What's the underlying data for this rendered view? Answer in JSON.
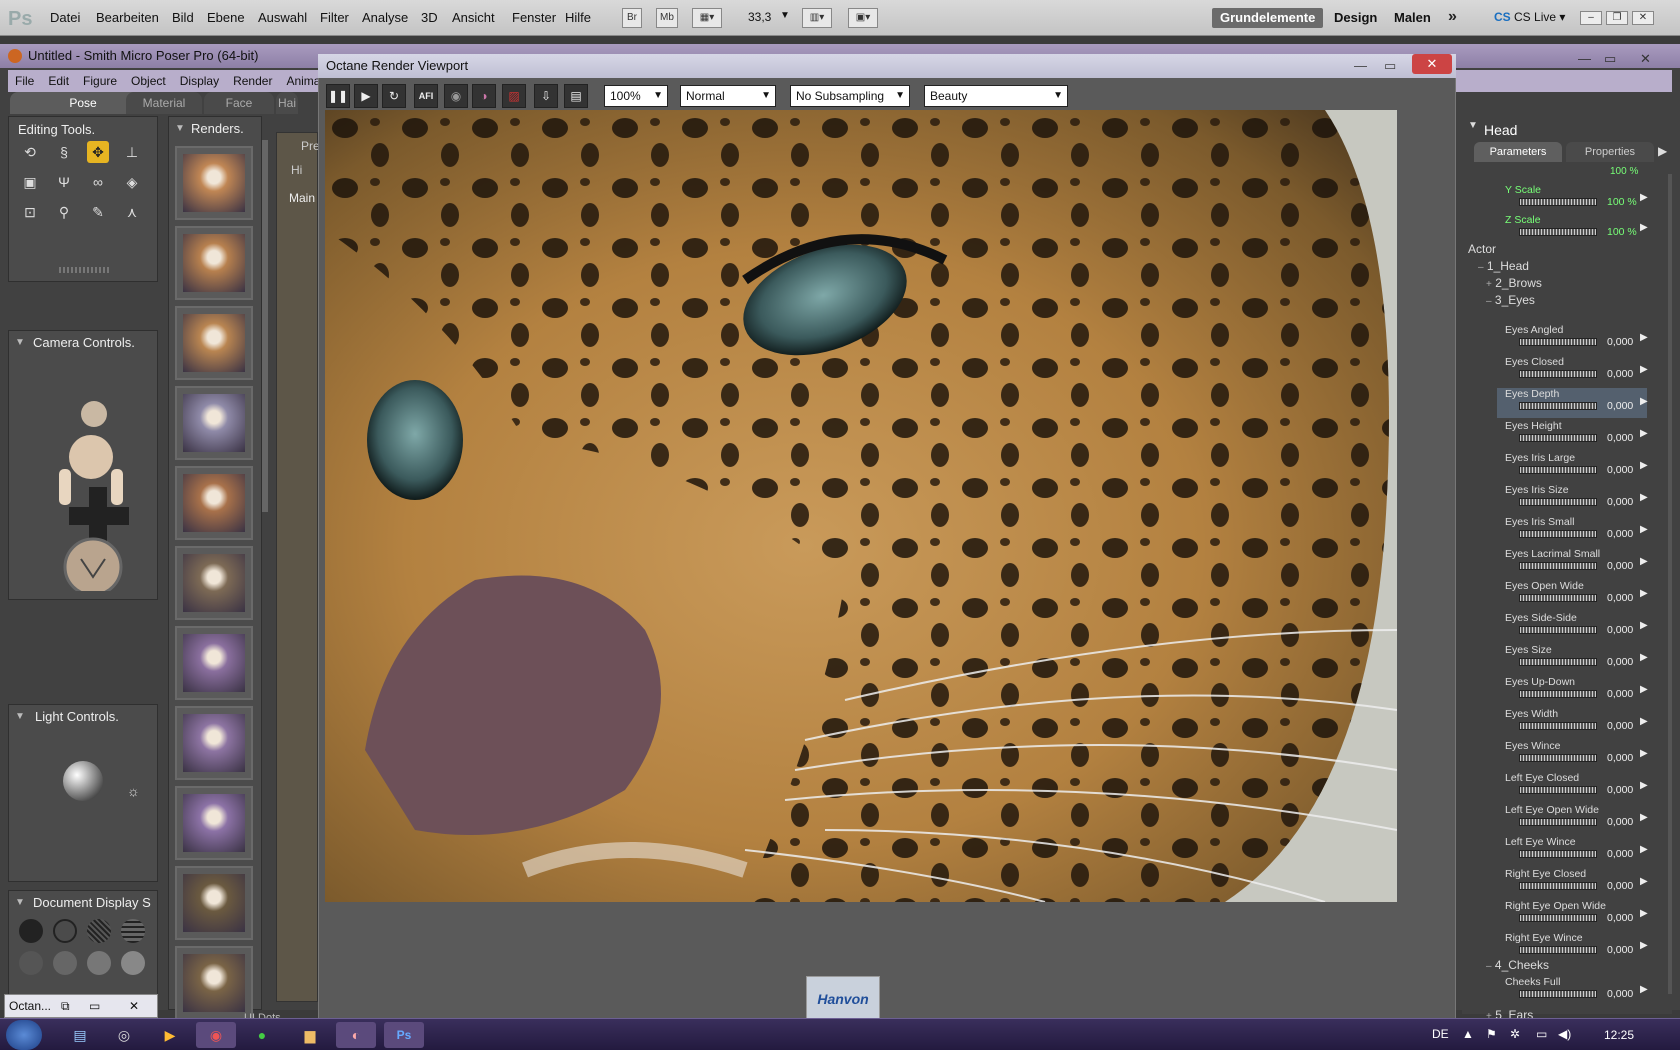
{
  "photoshop": {
    "logo": "Ps",
    "menu": [
      "Datei",
      "Bearbeiten",
      "Bild",
      "Ebene",
      "Auswahl",
      "Filter",
      "Analyse",
      "3D",
      "Ansicht",
      "Fenster",
      "Hilfe"
    ],
    "tool_badges": [
      "Br",
      "Mb"
    ],
    "zoom": "33,3",
    "workspaces": [
      "Grundelemente",
      "Design",
      "Malen"
    ],
    "overflow": "»",
    "cs_live": "CS Live"
  },
  "poser": {
    "title": "Untitled - Smith Micro Poser Pro  (64-bit)",
    "menu": [
      "File",
      "Edit",
      "Figure",
      "Object",
      "Display",
      "Render",
      "Animat"
    ],
    "tabs": [
      "Pose",
      "Material",
      "Face",
      "Hai"
    ],
    "editing_tools": "Editing Tools.",
    "renders": "Renders.",
    "camera_controls": "Camera Controls.",
    "light_controls": "Light Controls.",
    "document_display": "Document Display S",
    "behind_labels": {
      "pre": "Pre",
      "hi": "Hi",
      "main": "Main"
    },
    "bottom_label": "UI Dots"
  },
  "octane": {
    "title": "Octane Render Viewport",
    "zoom": "100%",
    "mode": "Normal",
    "subsampling": "No Subsampling",
    "pass": "Beauty",
    "afi_label": "AFI",
    "watermark": "Hanvon"
  },
  "right_panel": {
    "title": "Head",
    "tabs": [
      "Parameters",
      "Properties"
    ],
    "top_value": "100 %",
    "scales": [
      {
        "name": "Y Scale",
        "value": "100 %"
      },
      {
        "name": "Z Scale",
        "value": "100 %"
      }
    ],
    "tree": [
      "Actor",
      "1_Head",
      "2_Brows",
      "3_Eyes",
      "4_Cheeks",
      "5_Ears"
    ],
    "params": [
      {
        "name": "Eyes Angled",
        "value": "0,000"
      },
      {
        "name": "Eyes Closed",
        "value": "0,000"
      },
      {
        "name": "Eyes Depth",
        "value": "0,000"
      },
      {
        "name": "Eyes Height",
        "value": "0,000"
      },
      {
        "name": "Eyes Iris Large",
        "value": "0,000"
      },
      {
        "name": "Eyes Iris Size",
        "value": "0,000"
      },
      {
        "name": "Eyes Iris Small",
        "value": "0,000"
      },
      {
        "name": "Eyes Lacrimal Small",
        "value": "0,000"
      },
      {
        "name": "Eyes Open Wide",
        "value": "0,000"
      },
      {
        "name": "Eyes Side-Side",
        "value": "0,000"
      },
      {
        "name": "Eyes Size",
        "value": "0,000"
      },
      {
        "name": "Eyes Up-Down",
        "value": "0,000"
      },
      {
        "name": "Eyes Width",
        "value": "0,000"
      },
      {
        "name": "Eyes Wince",
        "value": "0,000"
      },
      {
        "name": "Left Eye Closed",
        "value": "0,000"
      },
      {
        "name": "Left Eye Open Wide",
        "value": "0,000"
      },
      {
        "name": "Left Eye Wince",
        "value": "0,000"
      },
      {
        "name": "Right Eye Closed",
        "value": "0,000"
      },
      {
        "name": "Right Eye Open Wide",
        "value": "0,000"
      },
      {
        "name": "Right Eye Wince",
        "value": "0,000"
      }
    ],
    "cheeks_param": {
      "name": "Cheeks Full",
      "value": "0,000"
    }
  },
  "taskbar": {
    "octane_label": "Octan...",
    "lang": "DE",
    "time": "12:25"
  }
}
